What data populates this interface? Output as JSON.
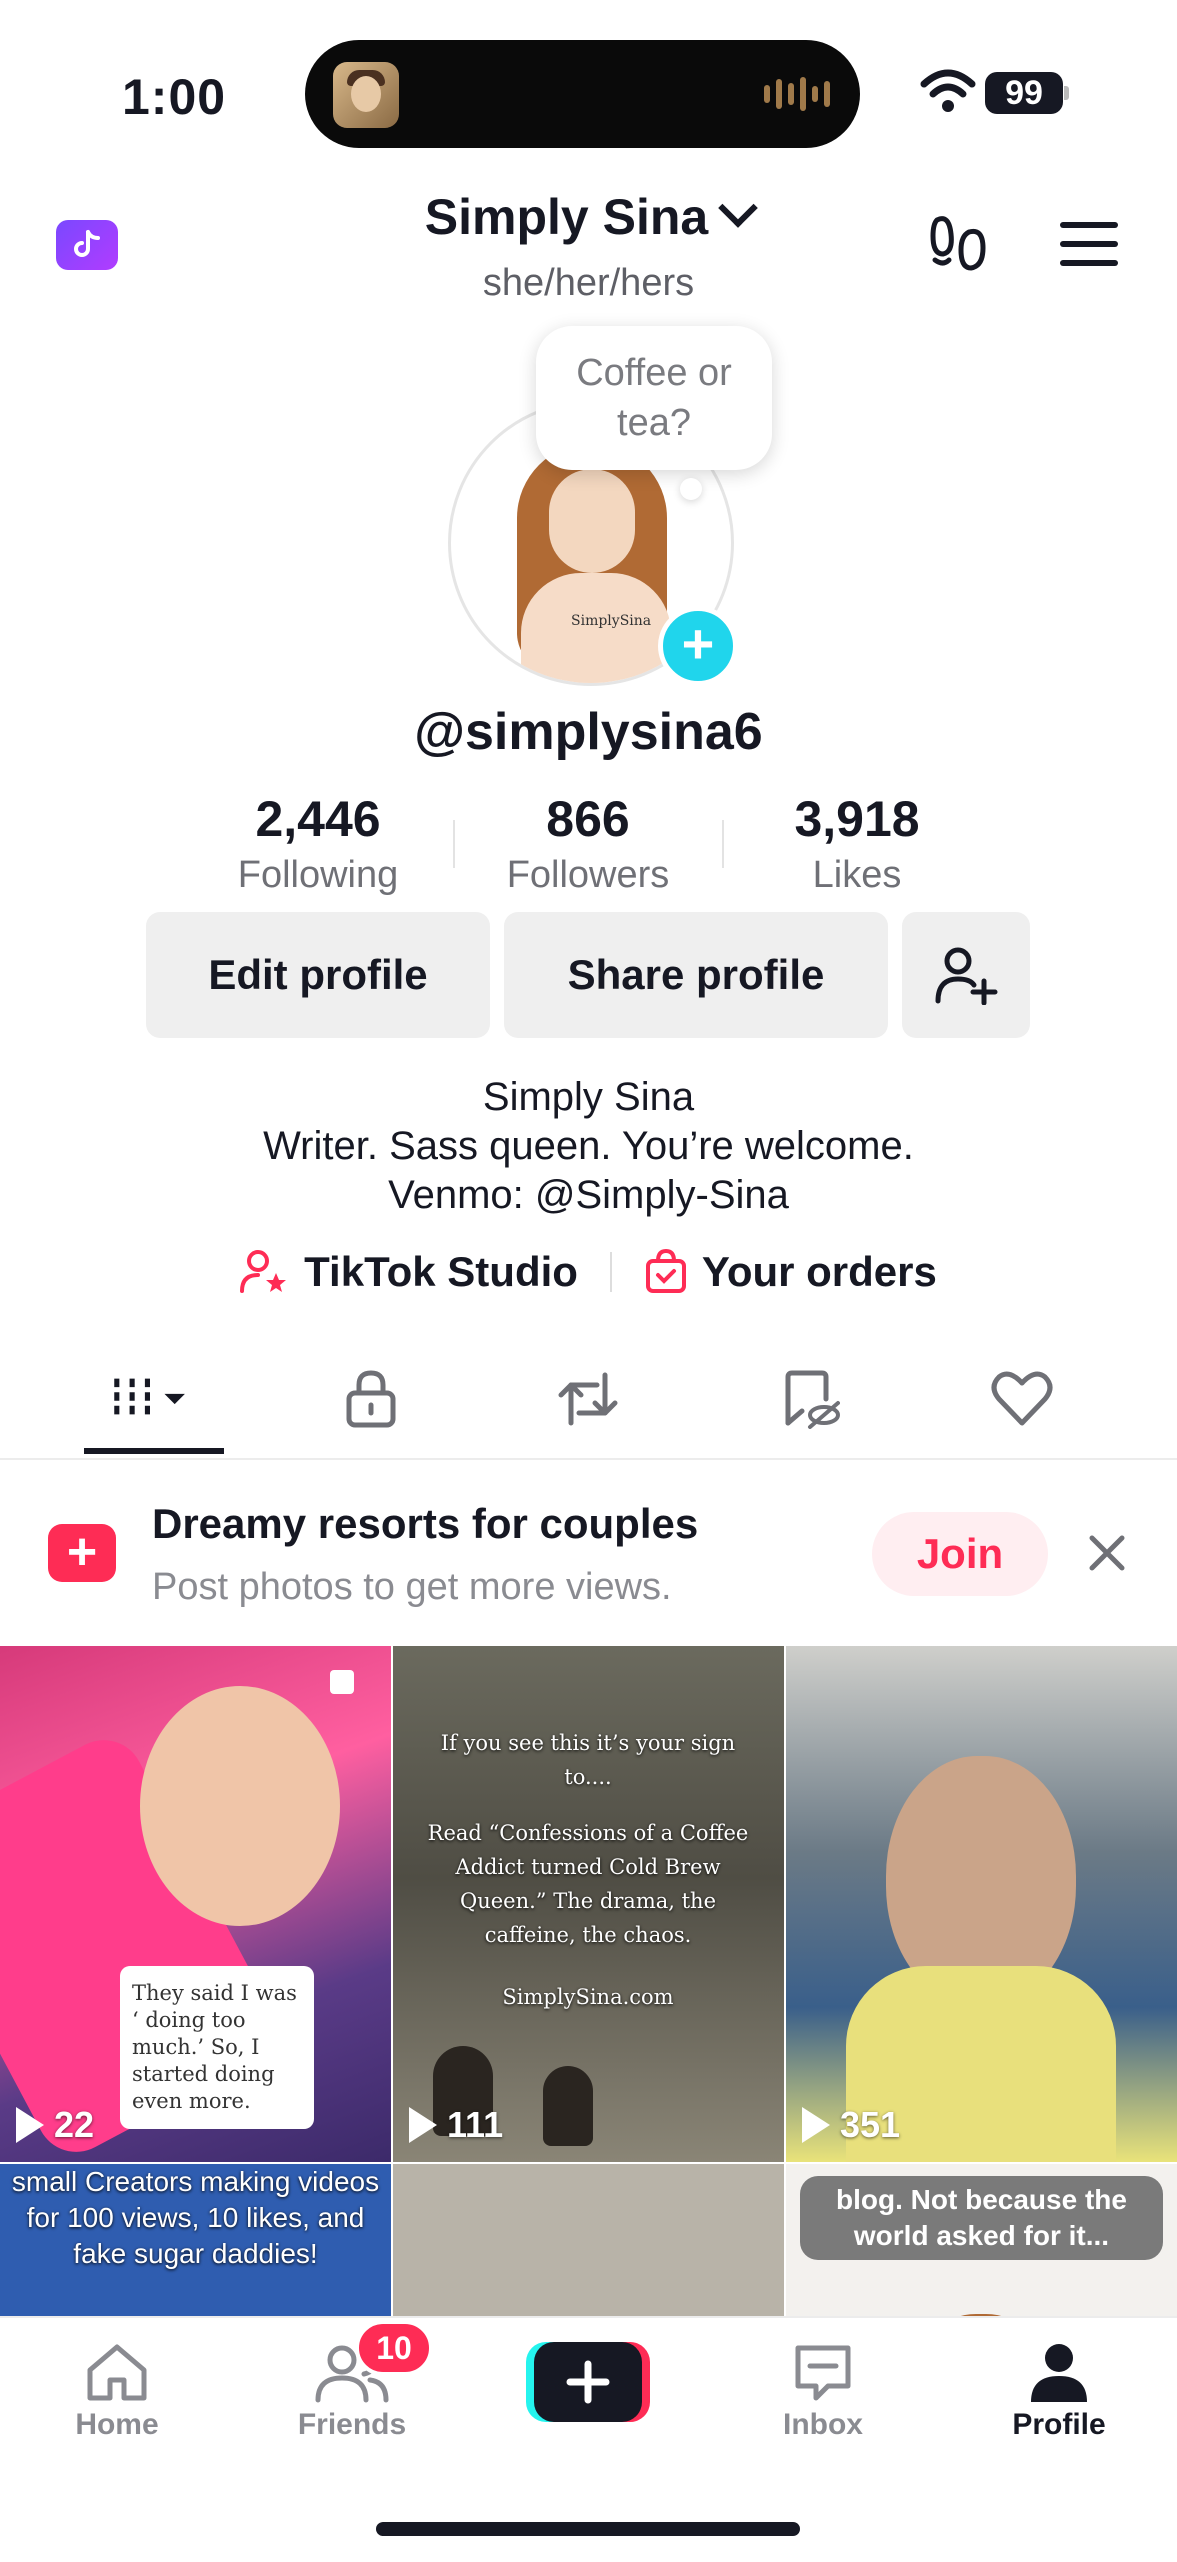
{
  "status_bar": {
    "time": "1:00",
    "battery": "99"
  },
  "header": {
    "title": "Simply Sina",
    "pronouns": "she/her/hers"
  },
  "profile": {
    "note_bubble": "Coffee or tea?",
    "avatar_signature": "SimplySina",
    "handle": "@simplysina6",
    "stats": [
      {
        "value": "2,446",
        "label": "Following"
      },
      {
        "value": "866",
        "label": "Followers"
      },
      {
        "value": "3,918",
        "label": "Likes"
      }
    ],
    "buttons": {
      "edit": "Edit profile",
      "share": "Share profile"
    },
    "bio": [
      "Simply Sina",
      "Writer. Sass queen. You’re welcome.",
      "Venmo: @Simply-Sina"
    ],
    "links": {
      "studio": "TikTok Studio",
      "orders": "Your orders"
    }
  },
  "promo": {
    "title": "Dreamy resorts for couples",
    "subtitle": "Post photos to get more views.",
    "join_label": "Join"
  },
  "videos": [
    {
      "views": "22",
      "caption": "They said I was ‘ doing too much.’ So, I started doing even more."
    },
    {
      "views": "111",
      "caption_top": "If you see this it’s your sign to....",
      "caption_mid": "Read “Confessions of a Coffee Addict turned Cold Brew Queen.” The drama, the caffeine, the chaos.",
      "caption_site": "SimplySina.com"
    },
    {
      "views": "351"
    },
    {
      "caption": "small Creators making videos for 100 views, 10 likes, and fake sugar daddies!"
    },
    {},
    {
      "caption": "blog. Not because the world asked for it..."
    }
  ],
  "bottom_nav": {
    "home": "Home",
    "friends": "Friends",
    "friends_badge": "10",
    "inbox": "Inbox",
    "profile": "Profile"
  }
}
